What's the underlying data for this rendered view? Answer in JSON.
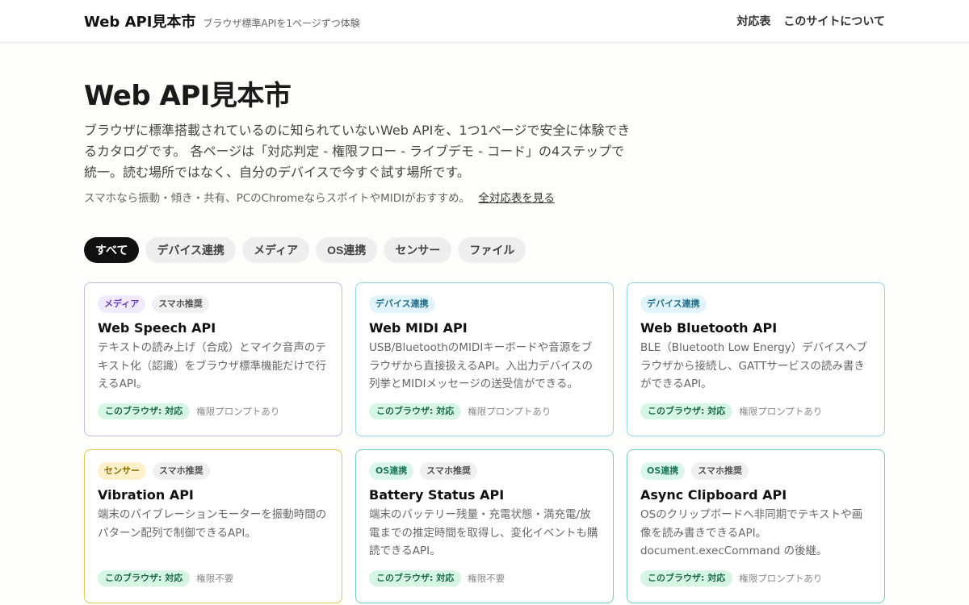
{
  "header": {
    "logo": "Web API見本市",
    "tagline": "ブラウザ標準APIを1ページずつ体験",
    "nav": [
      "対応表",
      "このサイトについて"
    ]
  },
  "hero": {
    "title": "Web API見本市",
    "lead": "ブラウザに標準搭載されているのに知られていないWeb APIを、1つ1ページで安全に体験できるカタログです。 各ページは「対応判定 - 権限フロー - ライブデモ - コード」の4ステップで統一。読む場所ではなく、自分のデバイスで今すぐ試す場所です。",
    "sub": "スマホなら振動・傾き・共有、PCのChromeならスポイトやMIDIがおすすめ。",
    "sub_link": "全対応表を見る"
  },
  "filters": [
    "すべて",
    "デバイス連携",
    "メディア",
    "OS連携",
    "センサー",
    "ファイル"
  ],
  "cards": [
    {
      "category": "メディア",
      "extra_tag": "スマホ推奨",
      "title": "Web Speech API",
      "desc": "テキストの読み上げ（合成）とマイク音声のテキスト化（認識）をブラウザ標準機能だけで行えるAPI。",
      "support": "このブラウザ: 対応",
      "permission": "権限プロンプトあり"
    },
    {
      "category": "デバイス連携",
      "extra_tag": "",
      "title": "Web MIDI API",
      "desc": "USB/BluetoothのMIDIキーボードや音源をブラウザから直接扱えるAPI。入出力デバイスの列挙とMIDIメッセージの送受信ができる。",
      "support": "このブラウザ: 対応",
      "permission": "権限プロンプトあり"
    },
    {
      "category": "デバイス連携",
      "extra_tag": "",
      "title": "Web Bluetooth API",
      "desc": "BLE（Bluetooth Low Energy）デバイスへブラウザから接続し、GATTサービスの読み書きができるAPI。",
      "support": "このブラウザ: 対応",
      "permission": "権限プロンプトあり"
    },
    {
      "category": "センサー",
      "extra_tag": "スマホ推奨",
      "title": "Vibration API",
      "desc": "端末のバイブレーションモーターを振動時間のパターン配列で制御できるAPI。",
      "support": "このブラウザ: 対応",
      "permission": "権限不要"
    },
    {
      "category": "OS連携",
      "extra_tag": "スマホ推奨",
      "title": "Battery Status API",
      "desc": "端末のバッテリー残量・充電状態・満充電/放電までの推定時間を取得し、変化イベントも購読できるAPI。",
      "support": "このブラウザ: 対応",
      "permission": "権限不要"
    },
    {
      "category": "OS連携",
      "extra_tag": "スマホ推奨",
      "title": "Async Clipboard API",
      "desc": "OSのクリップボードへ非同期でテキストや画像を読み書きできるAPI。document.execCommand の後継。",
      "support": "このブラウザ: 対応",
      "permission": "権限プロンプトあり"
    }
  ]
}
